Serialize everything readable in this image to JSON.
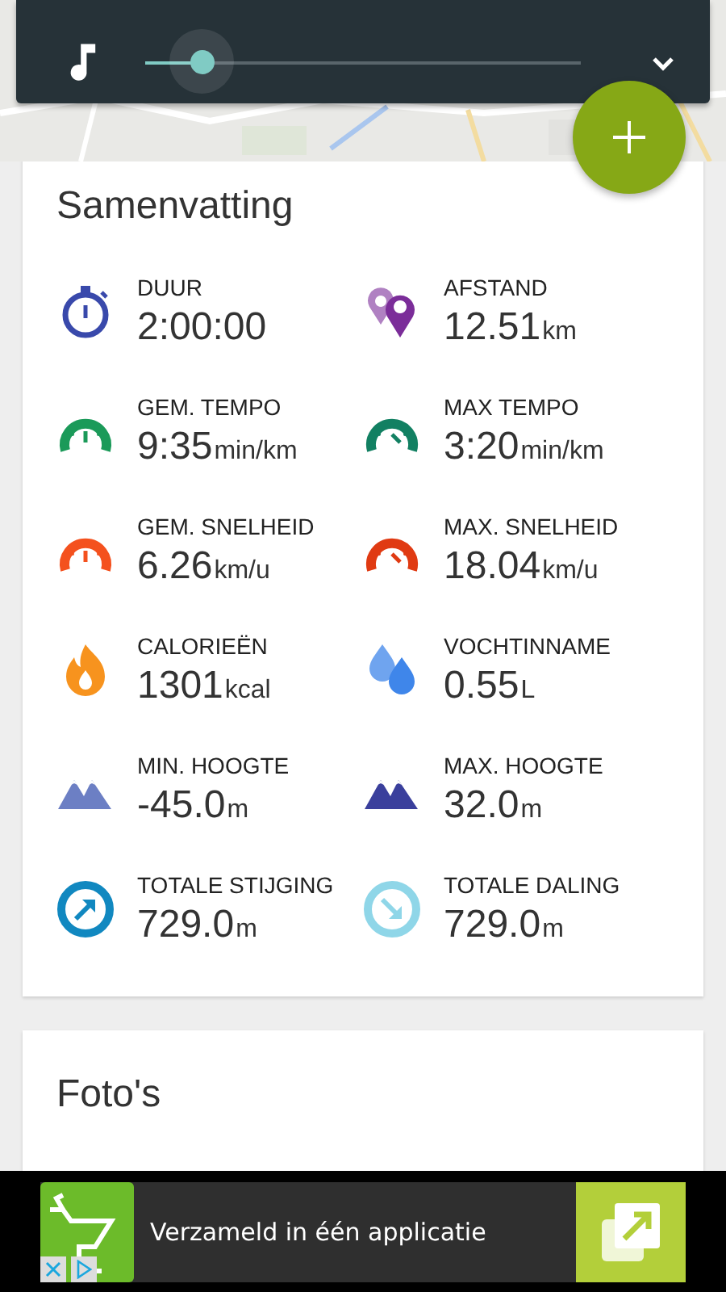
{
  "player": {
    "level": 0.13
  },
  "summary": {
    "title": "Samenvatting",
    "metrics": [
      {
        "kind": "stopwatch",
        "color": "#3949ab",
        "label": "DUUR",
        "value": "2:00:00"
      },
      {
        "kind": "pins",
        "color": "#7b2d99",
        "label": "AFSTAND",
        "value": "12.51",
        "unit": "km"
      },
      {
        "kind": "gauge",
        "color": "#1b9a59",
        "label": "GEM. TEMPO",
        "value": "9:35",
        "unit": "min/km"
      },
      {
        "kind": "gauge-max",
        "color": "#128062",
        "label": "MAX TEMPO",
        "value": "3:20",
        "unit": "min/km"
      },
      {
        "kind": "gauge",
        "color": "#f4511e",
        "label": "GEM. SNELHEID",
        "value": "6.26",
        "unit": "km/u"
      },
      {
        "kind": "gauge-max",
        "color": "#e03a12",
        "label": "MAX. SNELHEID",
        "value": "18.04",
        "unit": "km/u"
      },
      {
        "kind": "flame",
        "color": "#f7931e",
        "label": "CALORIEËN",
        "value": "1301",
        "unit": "kcal"
      },
      {
        "kind": "drops",
        "color": "#3f86ea",
        "label": "VOCHTINNAME",
        "value": "0.55",
        "unit": "L"
      },
      {
        "kind": "peaks",
        "color": "#6c7fc4",
        "label": "MIN. HOOGTE",
        "value": "-45.0",
        "unit": "m"
      },
      {
        "kind": "peaks",
        "color": "#3a3f9c",
        "label": "MAX. HOOGTE",
        "value": "32.0",
        "unit": "m"
      },
      {
        "kind": "ascent",
        "color": "#1188c0",
        "label": "TOTALE STIJGING",
        "value": "729.0",
        "unit": "m"
      },
      {
        "kind": "descent",
        "color": "#8fd6e8",
        "label": "TOTALE DALING",
        "value": "729.0",
        "unit": "m"
      }
    ]
  },
  "photos": {
    "title": "Foto's"
  },
  "ad": {
    "text": "Verzameld in één applicatie"
  }
}
